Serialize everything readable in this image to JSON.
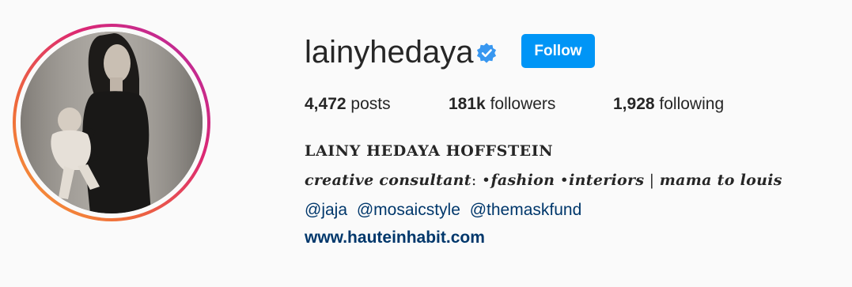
{
  "profile": {
    "username": "lainyhedaya",
    "verified_icon": "verified-badge-icon",
    "follow_label": "Follow",
    "accent_color": "#0095f6"
  },
  "stats": {
    "posts_count": "4,472",
    "posts_label": "posts",
    "followers_count": "181k",
    "followers_label": "followers",
    "following_count": "1,928",
    "following_label": "following"
  },
  "bio": {
    "full_name": "LAINY HEDAYA HOFFSTEIN",
    "line_1": [
      "creative consultant",
      ": •",
      "fashion",
      " •",
      "interiors",
      " | ",
      "mama to louis"
    ],
    "mentions": [
      "@jaja",
      "@mosaicstyle",
      "@themaskfund"
    ],
    "website": "www.hauteinhabit.com"
  }
}
